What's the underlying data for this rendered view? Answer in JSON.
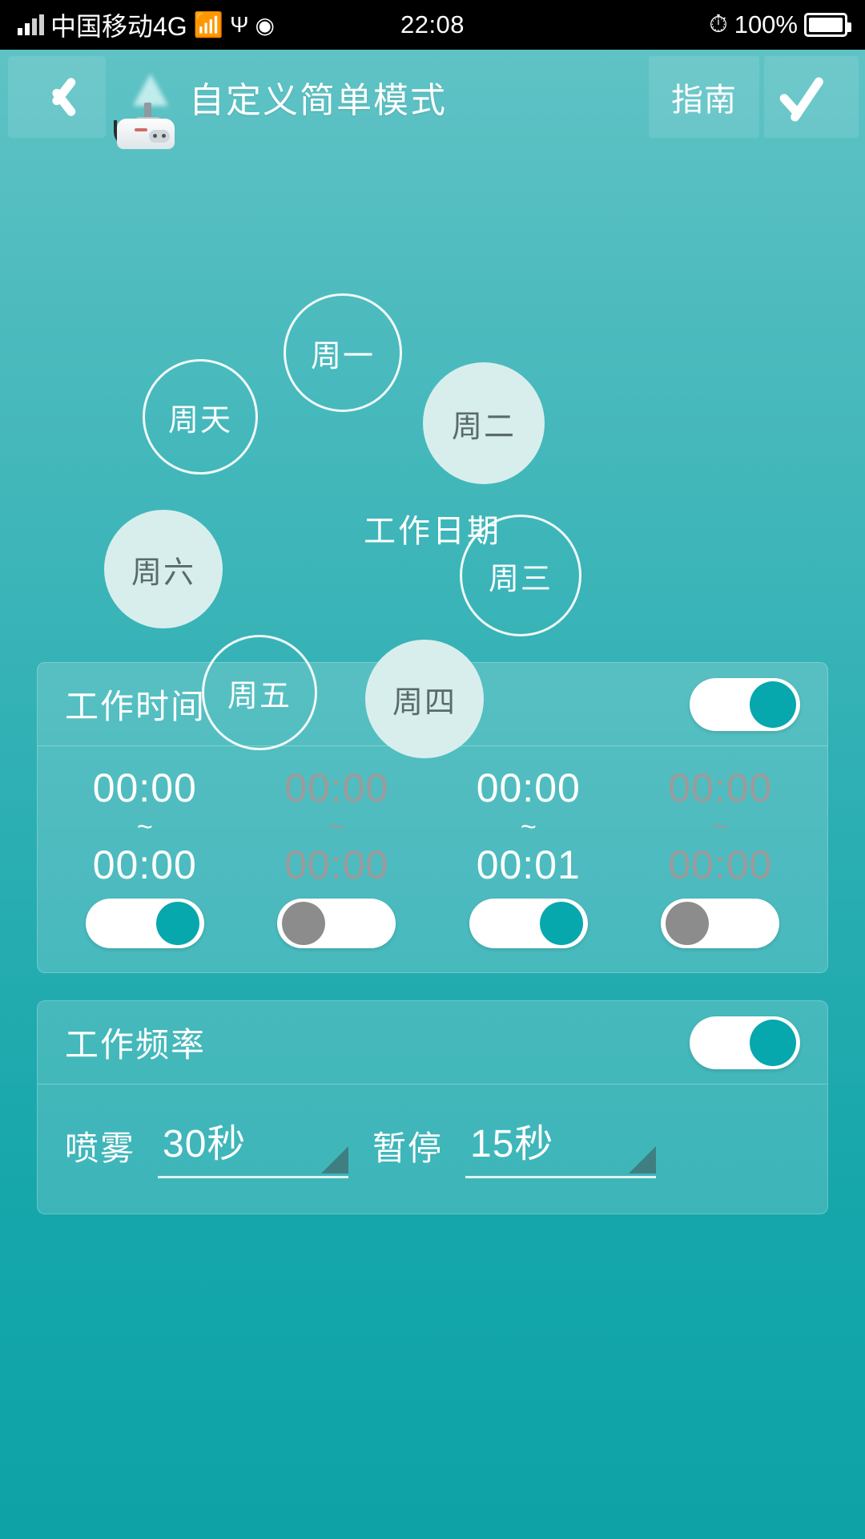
{
  "status_bar": {
    "carrier": "中国移动4G",
    "time": "22:08",
    "battery": "100%",
    "icons": [
      "signal-icon",
      "wifi-icon",
      "usb-icon",
      "android-robot-icon",
      "alarm-clock-icon",
      "battery-icon"
    ]
  },
  "header": {
    "back_icon": "chevron-left-icon",
    "device_icon": "sprayer-device-icon",
    "title": "自定义简单模式",
    "guide_label": "指南",
    "confirm_icon": "check-icon"
  },
  "days_section": {
    "center_label": "工作日期",
    "days": [
      {
        "label": "周一",
        "selected": false
      },
      {
        "label": "周二",
        "selected": true
      },
      {
        "label": "周三",
        "selected": false
      },
      {
        "label": "周四",
        "selected": true
      },
      {
        "label": "周五",
        "selected": false
      },
      {
        "label": "周六",
        "selected": true
      },
      {
        "label": "周天",
        "selected": false
      }
    ]
  },
  "work_time": {
    "title": "工作时间",
    "enabled": true,
    "separator": "~",
    "slots": [
      {
        "start": "00:00",
        "end": "00:00",
        "enabled": true
      },
      {
        "start": "00:00",
        "end": "00:00",
        "enabled": false
      },
      {
        "start": "00:00",
        "end": "00:01",
        "enabled": true
      },
      {
        "start": "00:00",
        "end": "00:00",
        "enabled": false
      }
    ]
  },
  "work_frequency": {
    "title": "工作频率",
    "enabled": true,
    "spray_label": "喷雾",
    "spray_value": "30秒",
    "pause_label": "暂停",
    "pause_value": "15秒"
  },
  "colors": {
    "bg_top": "#63c4c6",
    "bg_bottom": "#0ea2a6",
    "accent_teal": "#07a7ae",
    "selected_day_fill": "#d8eeed",
    "selected_day_text": "#5a6a6c",
    "disabled_gray": "#8c8c8c",
    "inactive_text": "#9e9a9a"
  }
}
